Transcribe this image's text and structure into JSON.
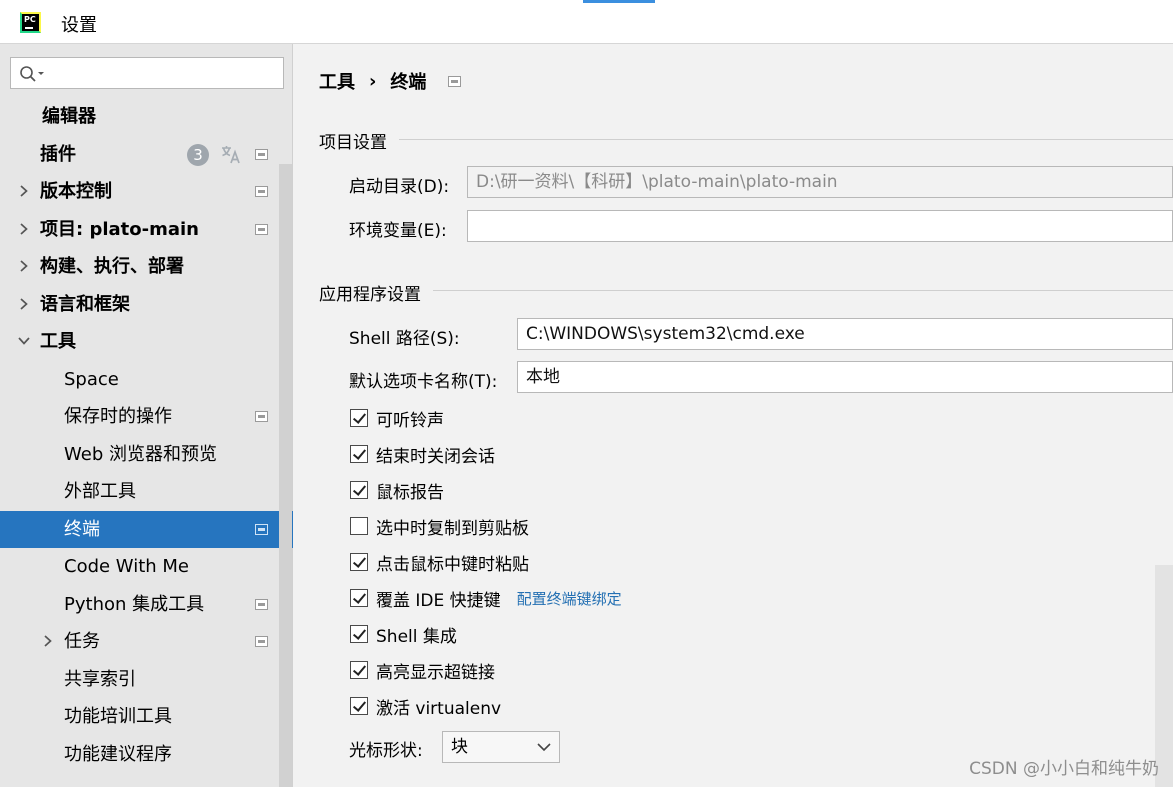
{
  "window": {
    "title": "设置",
    "logo_text": "PC"
  },
  "search": {
    "placeholder": ""
  },
  "sidebar": {
    "items": [
      {
        "label": "编辑器",
        "level": 0,
        "bold": true,
        "expandable": false
      },
      {
        "label": "插件",
        "level": 0,
        "bold": true,
        "expandable": false,
        "badge": "3",
        "translate_icon": true,
        "project_icon": true
      },
      {
        "label": "版本控制",
        "level": 0,
        "bold": true,
        "expandable": true,
        "expanded": false,
        "project_icon": true
      },
      {
        "label": "项目: plato-main",
        "level": 0,
        "bold": true,
        "expandable": true,
        "expanded": false,
        "project_icon": true
      },
      {
        "label": "构建、执行、部署",
        "level": 0,
        "bold": true,
        "expandable": true,
        "expanded": false
      },
      {
        "label": "语言和框架",
        "level": 0,
        "bold": true,
        "expandable": true,
        "expanded": false
      },
      {
        "label": "工具",
        "level": 0,
        "bold": true,
        "expandable": true,
        "expanded": true
      },
      {
        "label": "Space",
        "level": 1
      },
      {
        "label": "保存时的操作",
        "level": 1,
        "project_icon": true
      },
      {
        "label": "Web 浏览器和预览",
        "level": 1
      },
      {
        "label": "外部工具",
        "level": 1
      },
      {
        "label": "终端",
        "level": 1,
        "selected": true,
        "project_icon": true
      },
      {
        "label": "Code With Me",
        "level": 1
      },
      {
        "label": "Python 集成工具",
        "level": 1,
        "project_icon": true
      },
      {
        "label": "任务",
        "level": 1,
        "expandable": true,
        "expanded": false,
        "project_icon": true
      },
      {
        "label": "共享索引",
        "level": 1
      },
      {
        "label": "功能培训工具",
        "level": 1
      },
      {
        "label": "功能建议程序",
        "level": 1
      }
    ]
  },
  "breadcrumb": {
    "parent": "工具",
    "separator": "›",
    "current": "终端"
  },
  "project_settings": {
    "title": "项目设置",
    "start_dir_label": "启动目录(D):",
    "start_dir_value": "D:\\研一资料\\【科研】\\plato-main\\plato-main",
    "env_label": "环境变量(E):",
    "env_value": ""
  },
  "app_settings": {
    "title": "应用程序设置",
    "shell_path_label": "Shell 路径(S):",
    "shell_path_value": "C:\\WINDOWS\\system32\\cmd.exe",
    "tab_name_label": "默认选项卡名称(T):",
    "tab_name_value": "本地",
    "checkboxes": [
      {
        "label": "可听铃声",
        "checked": true
      },
      {
        "label": "结束时关闭会话",
        "checked": true
      },
      {
        "label": "鼠标报告",
        "checked": true
      },
      {
        "label": "选中时复制到剪贴板",
        "checked": false
      },
      {
        "label": "点击鼠标中键时粘贴",
        "checked": true
      },
      {
        "label": "覆盖 IDE 快捷键",
        "checked": true,
        "link": "配置终端键绑定"
      },
      {
        "label": "Shell 集成",
        "checked": true
      },
      {
        "label": "高亮显示超链接",
        "checked": true
      },
      {
        "label": "激活 virtualenv",
        "checked": true
      }
    ],
    "cursor_shape_label": "光标形状:",
    "cursor_shape_value": "块"
  },
  "watermark": "CSDN @小小白和纯牛奶",
  "colors": {
    "selection": "#2675bf",
    "link": "#2470b3",
    "accent": "#3b8fdf"
  }
}
